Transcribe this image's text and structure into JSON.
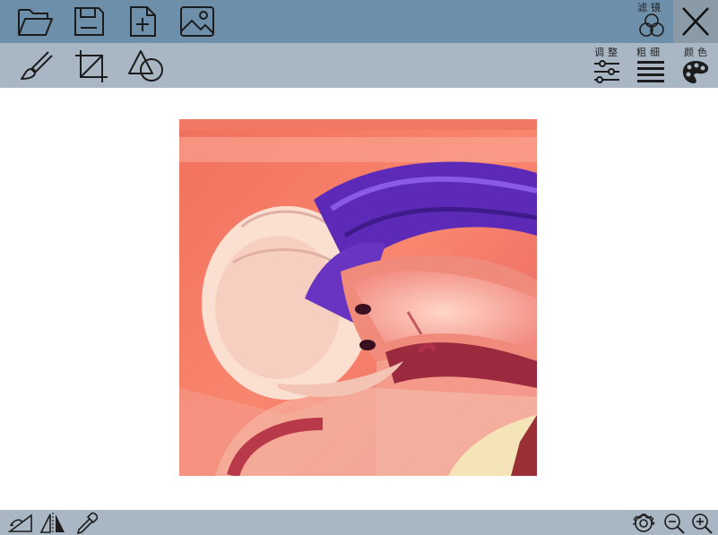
{
  "toolbar": {
    "filter_label": "滤镜",
    "adjust_label": "调整",
    "thickness_label": "粗细",
    "color_label": "颜色"
  },
  "icons": {
    "open": "folder-open-icon",
    "save": "save-icon",
    "new": "new-file-icon",
    "image": "image-icon",
    "filter": "filter-icon",
    "close": "close-icon",
    "brush": "brush-icon",
    "crop": "crop-icon",
    "shapes": "shapes-icon",
    "adjust": "sliders-icon",
    "thickness": "line-weight-icon",
    "color": "palette-icon",
    "rotate": "rotate-icon",
    "flip": "flip-icon",
    "eyedropper": "eyedropper-icon",
    "settings": "gear-icon",
    "zoom_out": "zoom-out-icon",
    "zoom_in": "zoom-in-icon"
  },
  "colors": {
    "top_bar": "#6e8faa",
    "tool_bar": "#a9b7c4",
    "status_bar": "#a9b7c4",
    "close_bg": "#8a9aa6"
  }
}
